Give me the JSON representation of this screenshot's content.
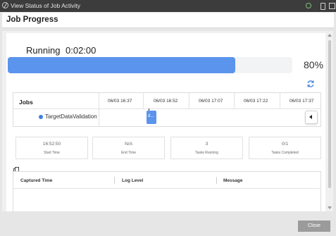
{
  "window": {
    "title": "View Status of Job Activity"
  },
  "header": {
    "title": "Job Progress"
  },
  "status": {
    "state": "Running",
    "elapsed": "0:02:00",
    "progress_percent": 80,
    "percent_label": "80%"
  },
  "jobs": {
    "header_label": "Jobs",
    "timestamps": [
      "06/03 16:37",
      "06/03 16:52",
      "06/03 17:07",
      "06/03 17:22",
      "06/03 17:37"
    ],
    "rows": [
      {
        "name": "TargetDataValidation",
        "bar_label": "d..."
      }
    ]
  },
  "stats": [
    {
      "value": "16:52:50",
      "label": "Start Time"
    },
    {
      "value": "N/A",
      "label": "End Time"
    },
    {
      "value": "3",
      "label": "Tasks Running"
    },
    {
      "value": "0/1",
      "label": "Tasks Completed"
    }
  ],
  "log": {
    "columns": [
      "Captured Time",
      "Log Level",
      "Message"
    ]
  },
  "footer": {
    "close_label": "Close"
  },
  "colors": {
    "accent": "#5b94ec",
    "titlebar": "#3c3c3c",
    "close_button": "#9b9b9b"
  }
}
